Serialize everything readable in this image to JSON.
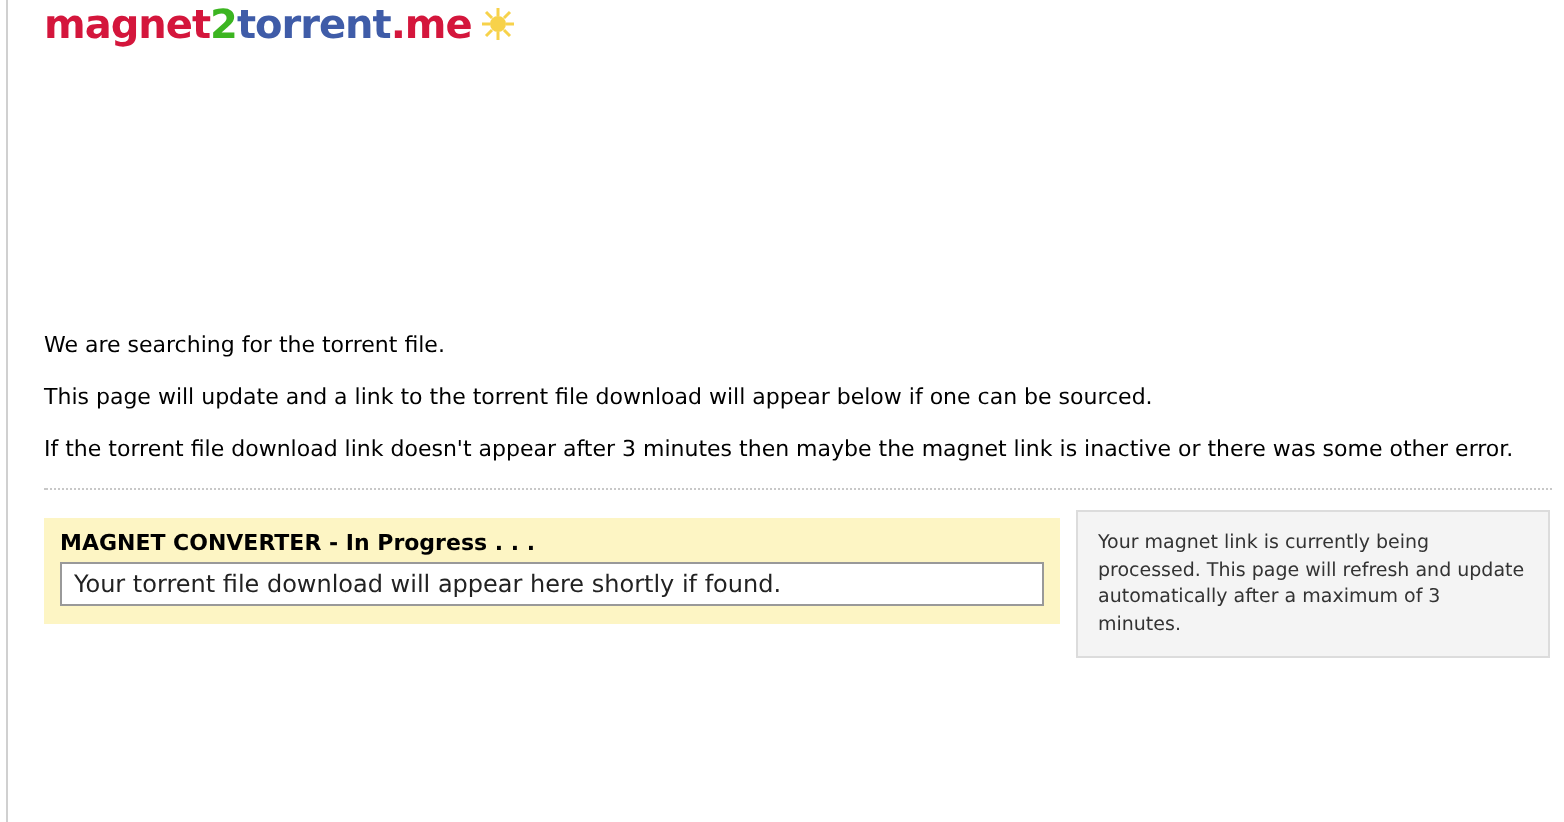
{
  "logo": {
    "parts": [
      {
        "text": "magnet",
        "color": "#d4163c"
      },
      {
        "text": "2",
        "color": "#3cb521"
      },
      {
        "text": "torrent",
        "color": "#3f5ca8"
      },
      {
        "text": ".me",
        "color": "#d4163c"
      }
    ]
  },
  "messages": [
    "We are searching for the torrent file.",
    "This page will update and a link to the torrent file download will appear below if one can be sourced.",
    "If the torrent file download link doesn't appear after 3 minutes then maybe the magnet link is inactive or there was some other error."
  ],
  "converter": {
    "title": "MAGNET CONVERTER - In Progress . . .",
    "value": "Your torrent file download will appear here shortly if found."
  },
  "note": "Your magnet link is currently being processed. This page will refresh and update automatically after a maximum of 3 minutes."
}
